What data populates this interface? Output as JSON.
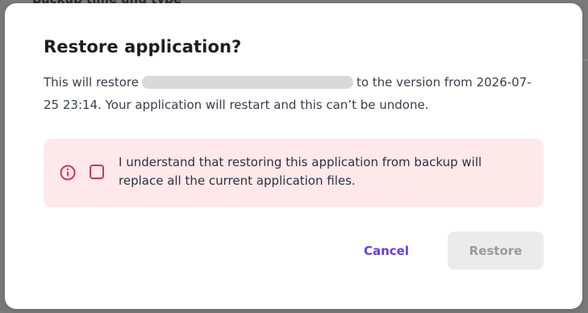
{
  "backdrop": {
    "heading": "Backup time and type"
  },
  "dialog": {
    "title": "Restore application?",
    "description_prefix": "This will restore",
    "description_suffix": "to the version from 2026-07-25 23:14. Your application will restart and this can’t be undone.",
    "alert": {
      "icon": "info-icon",
      "checkbox_checked": false,
      "text": "I understand that restoring this application from backup will replace all the current application files."
    },
    "buttons": {
      "cancel_label": "Cancel",
      "restore_label": "Restore",
      "restore_disabled": true
    }
  },
  "colors": {
    "accent": "#673de6",
    "alert_background": "#fde9ea",
    "alert_border": "#d63163",
    "disabled_button_bg": "#ebebeb",
    "disabled_button_text": "#9b9b9b"
  }
}
